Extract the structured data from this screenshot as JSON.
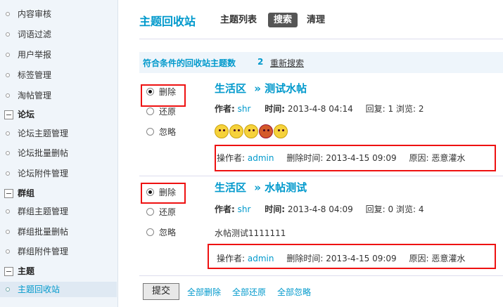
{
  "sidebar": {
    "items": [
      {
        "label": "内容审核",
        "type": "item"
      },
      {
        "label": "词语过滤",
        "type": "item"
      },
      {
        "label": "用户举报",
        "type": "item"
      },
      {
        "label": "标签管理",
        "type": "item"
      },
      {
        "label": "淘帖管理",
        "type": "item"
      },
      {
        "label": "论坛",
        "type": "group"
      },
      {
        "label": "论坛主题管理",
        "type": "item"
      },
      {
        "label": "论坛批量删帖",
        "type": "item"
      },
      {
        "label": "论坛附件管理",
        "type": "item"
      },
      {
        "label": "群组",
        "type": "group"
      },
      {
        "label": "群组主题管理",
        "type": "item"
      },
      {
        "label": "群组批量删帖",
        "type": "item"
      },
      {
        "label": "群组附件管理",
        "type": "item"
      },
      {
        "label": "主题",
        "type": "group"
      },
      {
        "label": "主题回收站",
        "type": "item",
        "active": true
      }
    ]
  },
  "header": {
    "title": "主题回收站",
    "tabs": [
      "主题列表",
      "搜索",
      "清理"
    ],
    "active_tab": "搜索"
  },
  "summary": {
    "text": "符合条件的回收站主题数",
    "count": "2",
    "research_link": "重新搜索"
  },
  "options": {
    "delete": "删除",
    "restore": "还原",
    "ignore": "忽略"
  },
  "meta_labels": {
    "author": "作者:",
    "time": "时间:",
    "reply": "回复:",
    "views": "浏览:",
    "operator": "操作者:",
    "delete_time": "删除时间:",
    "reason": "原因:"
  },
  "posts": [
    {
      "forum": "生活区",
      "title": "» 测试水帖",
      "author": "shr",
      "time": "2013-4-8 04:14",
      "replies": "1",
      "views": "2",
      "content_type": "emoji",
      "emojis": [
        "smile-emoji",
        "sad-emoji",
        "grin-emoji",
        "angry-emoji",
        "smile-emoji"
      ],
      "operator": "admin",
      "delete_time": "2013-4-15 09:09",
      "reason": "恶意灌水",
      "selected": "delete"
    },
    {
      "forum": "生活区",
      "title": "» 水帖测试",
      "author": "shr",
      "time": "2013-4-8 04:09",
      "replies": "0",
      "views": "4",
      "content_type": "text",
      "content": "水帖测试1111111",
      "operator": "admin",
      "delete_time": "2013-4-15 09:09",
      "reason": "恶意灌水",
      "selected": "delete"
    }
  ],
  "footer": {
    "submit": "提交",
    "links": [
      "全部删除",
      "全部还原",
      "全部忽略"
    ]
  },
  "colors": {
    "accent": "#0099cc",
    "highlight_border": "#ee1111",
    "sidebar_bg": "#f0f5fa"
  }
}
